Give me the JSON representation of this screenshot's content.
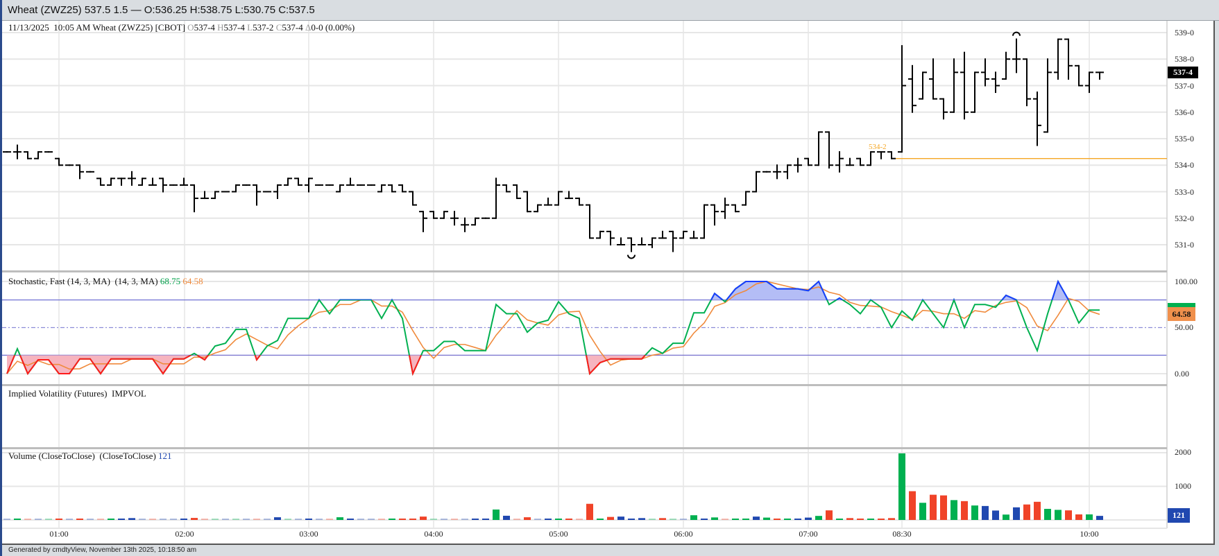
{
  "window": {
    "title": "Wheat (ZWZ25) 537.5 1.5 — O:536.25 H:538.75 L:530.75 C:537.5"
  },
  "legend": {
    "date": "11/13/2025",
    "time": "10:05 AM",
    "symbol": "Wheat (ZWZ25) [CBOT]",
    "o_label": "O",
    "o": "537-4",
    "h_label": "H",
    "h": "537-4",
    "l_label": "L",
    "l": "537-2",
    "c_label": "C",
    "c": "537-4",
    "d_label": "Δ",
    "d": "0-0 (0.00%)"
  },
  "price_axis": [
    "539-0",
    "538-0",
    "537-0",
    "536-0",
    "535-0",
    "534-0",
    "533-0",
    "532-0",
    "531-0"
  ],
  "price_tag": "537-4",
  "ref_line": {
    "value": 534.25,
    "label": "534-2",
    "color": "#f5a623"
  },
  "stoch": {
    "title": "Stochastic, Fast (14, 3, MA)  (14, 3, MA)",
    "k_value": "68.75",
    "d_value": "64.58",
    "axis": [
      "100.00",
      "50.00",
      "0.00"
    ],
    "tag": "64.58",
    "k_color": "#00b050",
    "d_color": "#f08a3c",
    "upper": 80,
    "lower": 20
  },
  "impvol": {
    "title": "Implied Volatility (Futures)  IMPVOL"
  },
  "volume": {
    "title": "Volume (CloseToClose)  (CloseToClose)",
    "value": "121",
    "axis": [
      "2000",
      "1000"
    ],
    "tag": "121"
  },
  "time_axis": [
    "01:00",
    "02:00",
    "03:00",
    "04:00",
    "05:00",
    "06:00",
    "07:00",
    "08:30",
    "10:00"
  ],
  "status": "Generated by cmdtyView, November 13th 2025, 10:18:50 am",
  "chart_data": {
    "type": "ohlc",
    "price_range": [
      530.5,
      539.25
    ],
    "bars": [
      [
        534.5,
        534.5,
        534.5,
        534.5
      ],
      [
        534.5,
        534.75,
        534.25,
        534.5
      ],
      [
        534.5,
        534.5,
        534.25,
        534.25
      ],
      [
        534.25,
        534.5,
        534.25,
        534.5
      ],
      [
        534.5,
        534.5,
        534.5,
        534.5
      ],
      [
        534.25,
        534.25,
        534,
        534
      ],
      [
        534,
        534,
        534,
        534
      ],
      [
        534,
        534,
        533.5,
        533.75
      ],
      [
        533.75,
        533.75,
        533.75,
        533.75
      ],
      [
        533.5,
        533.5,
        533.25,
        533.25
      ],
      [
        533.25,
        533.5,
        533.25,
        533.5
      ],
      [
        533.5,
        533.5,
        533.25,
        533.5
      ],
      [
        533.5,
        533.75,
        533.25,
        533.5
      ],
      [
        533.25,
        533.5,
        533.25,
        533.5
      ],
      [
        533.25,
        533.5,
        533.25,
        533.25
      ],
      [
        533.5,
        533.5,
        533,
        533.25
      ],
      [
        533.25,
        533.25,
        533.25,
        533.25
      ],
      [
        533.25,
        533.5,
        533.25,
        533.25
      ],
      [
        533.25,
        533.25,
        532.25,
        532.75
      ],
      [
        532.75,
        533,
        532.75,
        532.75
      ],
      [
        532.75,
        533,
        532.75,
        533
      ],
      [
        533,
        533,
        533,
        533
      ],
      [
        533,
        533.25,
        533,
        533.25
      ],
      [
        533.25,
        533.25,
        533.25,
        533.25
      ],
      [
        533.25,
        533.25,
        532.5,
        533
      ],
      [
        533,
        533,
        533,
        533
      ],
      [
        533,
        533.25,
        532.75,
        533.25
      ],
      [
        533.25,
        533.5,
        533.25,
        533.5
      ],
      [
        533.5,
        533.5,
        533.25,
        533.25
      ],
      [
        533.25,
        533.5,
        533,
        533.5
      ],
      [
        533.25,
        533.25,
        533.25,
        533.25
      ],
      [
        533.25,
        533.25,
        533.25,
        533.25
      ],
      [
        533,
        533.25,
        533,
        533.25
      ],
      [
        533.25,
        533.5,
        533.25,
        533.25
      ],
      [
        533.25,
        533.25,
        533.25,
        533.25
      ],
      [
        533.25,
        533.25,
        533.25,
        533.25
      ],
      [
        533,
        533.25,
        533,
        533.25
      ],
      [
        533.25,
        533.25,
        533,
        533
      ],
      [
        533.25,
        533.25,
        533,
        533
      ],
      [
        533,
        533,
        532.5,
        532.5
      ],
      [
        532.25,
        532.25,
        531.5,
        532
      ],
      [
        532.25,
        532.25,
        532,
        532
      ],
      [
        532,
        532.25,
        532,
        532.25
      ],
      [
        532,
        532.25,
        531.75,
        532
      ],
      [
        531.75,
        532,
        531.5,
        531.75
      ],
      [
        531.75,
        532,
        531.75,
        532
      ],
      [
        532,
        532,
        532,
        532
      ],
      [
        532,
        533.5,
        532,
        533.25
      ],
      [
        533.25,
        533.25,
        533,
        533
      ],
      [
        533.25,
        533.25,
        532.75,
        532.75
      ],
      [
        533,
        533,
        532.25,
        532.25
      ],
      [
        532.25,
        532.5,
        532.25,
        532.5
      ],
      [
        532.5,
        532.75,
        532.5,
        532.5
      ],
      [
        532.5,
        533,
        532.5,
        533
      ],
      [
        532.75,
        533,
        532.75,
        532.75
      ],
      [
        532.75,
        532.75,
        532.5,
        532.5
      ],
      [
        532.5,
        532.5,
        531.25,
        531.25
      ],
      [
        531.25,
        531.5,
        531.25,
        531.5
      ],
      [
        531.5,
        531.5,
        531,
        531.25
      ],
      [
        531,
        531.25,
        531,
        531
      ],
      [
        531.25,
        531.25,
        530.75,
        531
      ],
      [
        531,
        531.25,
        531,
        531
      ],
      [
        531,
        531.25,
        530.9,
        531.25
      ],
      [
        531.25,
        531.5,
        531.25,
        531.25
      ],
      [
        531.5,
        531.5,
        530.75,
        531.25
      ],
      [
        531.25,
        531.5,
        531.25,
        531.5
      ],
      [
        531.25,
        531.5,
        531.25,
        531.25
      ],
      [
        531.25,
        532.5,
        531.25,
        532.5
      ],
      [
        532.5,
        532.5,
        531.75,
        532.25
      ],
      [
        532.25,
        532.75,
        532,
        532.5
      ],
      [
        532.5,
        532.5,
        532.25,
        532.25
      ],
      [
        532.5,
        533,
        532.5,
        533
      ],
      [
        533,
        533.75,
        533,
        533.75
      ],
      [
        533.75,
        533.75,
        533.75,
        533.75
      ],
      [
        533.75,
        534,
        533.5,
        533.75
      ],
      [
        533.75,
        534,
        533.5,
        534
      ],
      [
        534,
        534.25,
        533.75,
        534
      ],
      [
        534.25,
        534.25,
        534,
        534
      ],
      [
        534,
        535.25,
        534,
        535.25
      ],
      [
        535.25,
        535.25,
        533.9,
        534
      ],
      [
        534,
        534.5,
        533.75,
        534.25
      ],
      [
        534,
        534.25,
        534,
        534
      ],
      [
        534.25,
        534.25,
        534,
        534
      ],
      [
        534,
        534.5,
        534,
        534.5
      ],
      [
        534.5,
        534.5,
        534.25,
        534.5
      ],
      [
        534.5,
        534.5,
        534.25,
        534.25
      ],
      [
        534.5,
        538.5,
        534.5,
        537
      ],
      [
        537.25,
        537.75,
        536,
        536.25
      ],
      [
        536.5,
        537.5,
        536.5,
        537.5
      ],
      [
        537.25,
        538,
        536.5,
        536.5
      ],
      [
        536.5,
        536.5,
        535.75,
        536
      ],
      [
        536,
        538,
        536,
        537.5
      ],
      [
        537.5,
        538.25,
        535.75,
        536
      ],
      [
        536,
        537.5,
        536,
        537.5
      ],
      [
        537.5,
        538,
        537,
        537.25
      ],
      [
        537.25,
        537.5,
        536.75,
        537
      ],
      [
        537.25,
        538.25,
        537.25,
        538
      ],
      [
        538,
        538.75,
        537.5,
        538
      ],
      [
        538,
        538,
        536.25,
        536.5
      ],
      [
        536.5,
        536.75,
        534.75,
        535.5
      ],
      [
        535.25,
        538,
        535.25,
        537.5
      ],
      [
        537.5,
        538.75,
        537.25,
        538.75
      ],
      [
        538.75,
        538.75,
        537.25,
        537.75
      ],
      [
        537.75,
        537.75,
        537,
        537
      ],
      [
        537,
        537.5,
        536.75,
        537.5
      ],
      [
        537.5,
        537.5,
        537.25,
        537.5
      ]
    ],
    "session_break_after_index": 85,
    "low_marker_index": 60,
    "high_marker_index": 97,
    "stoch_k": [
      0,
      27,
      0,
      15,
      15,
      0,
      0,
      16,
      16,
      0,
      16,
      16,
      16,
      16,
      16,
      0,
      16,
      16,
      22,
      15,
      30,
      33,
      48,
      48,
      15,
      30,
      36,
      60,
      60,
      60,
      80,
      65,
      80,
      80,
      80,
      80,
      60,
      80,
      60,
      0,
      25,
      25,
      35,
      35,
      25,
      25,
      25,
      75,
      65,
      65,
      45,
      55,
      58,
      78,
      65,
      60,
      0,
      12,
      16,
      16,
      16,
      16,
      28,
      22,
      33,
      33,
      66,
      66,
      87,
      78,
      92,
      100,
      100,
      100,
      92,
      92,
      92,
      90,
      100,
      75,
      82,
      75,
      65,
      80,
      72,
      50,
      68,
      58,
      80,
      65,
      50,
      80,
      50,
      75,
      75,
      72,
      85,
      80,
      50,
      25,
      65,
      100,
      80,
      55,
      69,
      69
    ],
    "volume": [
      [
        5,
        "b"
      ],
      [
        20,
        "g"
      ],
      [
        10,
        "r"
      ],
      [
        5,
        "b"
      ],
      [
        5,
        "g"
      ],
      [
        15,
        "r"
      ],
      [
        5,
        "b"
      ],
      [
        20,
        "r"
      ],
      [
        5,
        "b"
      ],
      [
        10,
        "r"
      ],
      [
        15,
        "g"
      ],
      [
        40,
        "b"
      ],
      [
        55,
        "b"
      ],
      [
        5,
        "b"
      ],
      [
        10,
        "r"
      ],
      [
        10,
        "b"
      ],
      [
        5,
        "b"
      ],
      [
        20,
        "b"
      ],
      [
        60,
        "r"
      ],
      [
        5,
        "r"
      ],
      [
        10,
        "g"
      ],
      [
        5,
        "b"
      ],
      [
        10,
        "g"
      ],
      [
        5,
        "b"
      ],
      [
        5,
        "r"
      ],
      [
        5,
        "b"
      ],
      [
        80,
        "b"
      ],
      [
        10,
        "g"
      ],
      [
        10,
        "b"
      ],
      [
        40,
        "b"
      ],
      [
        5,
        "b"
      ],
      [
        10,
        "r"
      ],
      [
        80,
        "g"
      ],
      [
        20,
        "b"
      ],
      [
        5,
        "b"
      ],
      [
        5,
        "b"
      ],
      [
        5,
        "r"
      ],
      [
        30,
        "g"
      ],
      [
        20,
        "r"
      ],
      [
        20,
        "r"
      ],
      [
        100,
        "r"
      ],
      [
        10,
        "g"
      ],
      [
        10,
        "b"
      ],
      [
        10,
        "r"
      ],
      [
        10,
        "b"
      ],
      [
        30,
        "b"
      ],
      [
        40,
        "b"
      ],
      [
        310,
        "g"
      ],
      [
        125,
        "b"
      ],
      [
        10,
        "r"
      ],
      [
        80,
        "r"
      ],
      [
        5,
        "b"
      ],
      [
        30,
        "b"
      ],
      [
        40,
        "g"
      ],
      [
        25,
        "r"
      ],
      [
        10,
        "r"
      ],
      [
        480,
        "r"
      ],
      [
        15,
        "g"
      ],
      [
        90,
        "r"
      ],
      [
        100,
        "b"
      ],
      [
        40,
        "b"
      ],
      [
        55,
        "b"
      ],
      [
        10,
        "g"
      ],
      [
        55,
        "r"
      ],
      [
        10,
        "g"
      ],
      [
        10,
        "b"
      ],
      [
        140,
        "g"
      ],
      [
        35,
        "b"
      ],
      [
        75,
        "g"
      ],
      [
        5,
        "r"
      ],
      [
        35,
        "g"
      ],
      [
        35,
        "g"
      ],
      [
        100,
        "b"
      ],
      [
        70,
        "g"
      ],
      [
        40,
        "r"
      ],
      [
        40,
        "g"
      ],
      [
        40,
        "b"
      ],
      [
        70,
        "b"
      ],
      [
        120,
        "g"
      ],
      [
        285,
        "r"
      ],
      [
        15,
        "g"
      ],
      [
        55,
        "r"
      ],
      [
        35,
        "r"
      ],
      [
        35,
        "g"
      ],
      [
        20,
        "r"
      ],
      [
        55,
        "r"
      ],
      [
        1980,
        "g"
      ],
      [
        855,
        "r"
      ],
      [
        510,
        "g"
      ],
      [
        750,
        "r"
      ],
      [
        730,
        "r"
      ],
      [
        590,
        "g"
      ],
      [
        560,
        "r"
      ],
      [
        430,
        "g"
      ],
      [
        415,
        "b"
      ],
      [
        280,
        "b"
      ],
      [
        160,
        "g"
      ],
      [
        375,
        "b"
      ],
      [
        460,
        "r"
      ],
      [
        540,
        "r"
      ],
      [
        330,
        "g"
      ],
      [
        300,
        "g"
      ],
      [
        285,
        "r"
      ],
      [
        165,
        "r"
      ],
      [
        165,
        "g"
      ],
      [
        121,
        "b"
      ]
    ],
    "volume_colors": {
      "g": "#00b050",
      "r": "#f04328",
      "b": "#2048b0"
    }
  }
}
